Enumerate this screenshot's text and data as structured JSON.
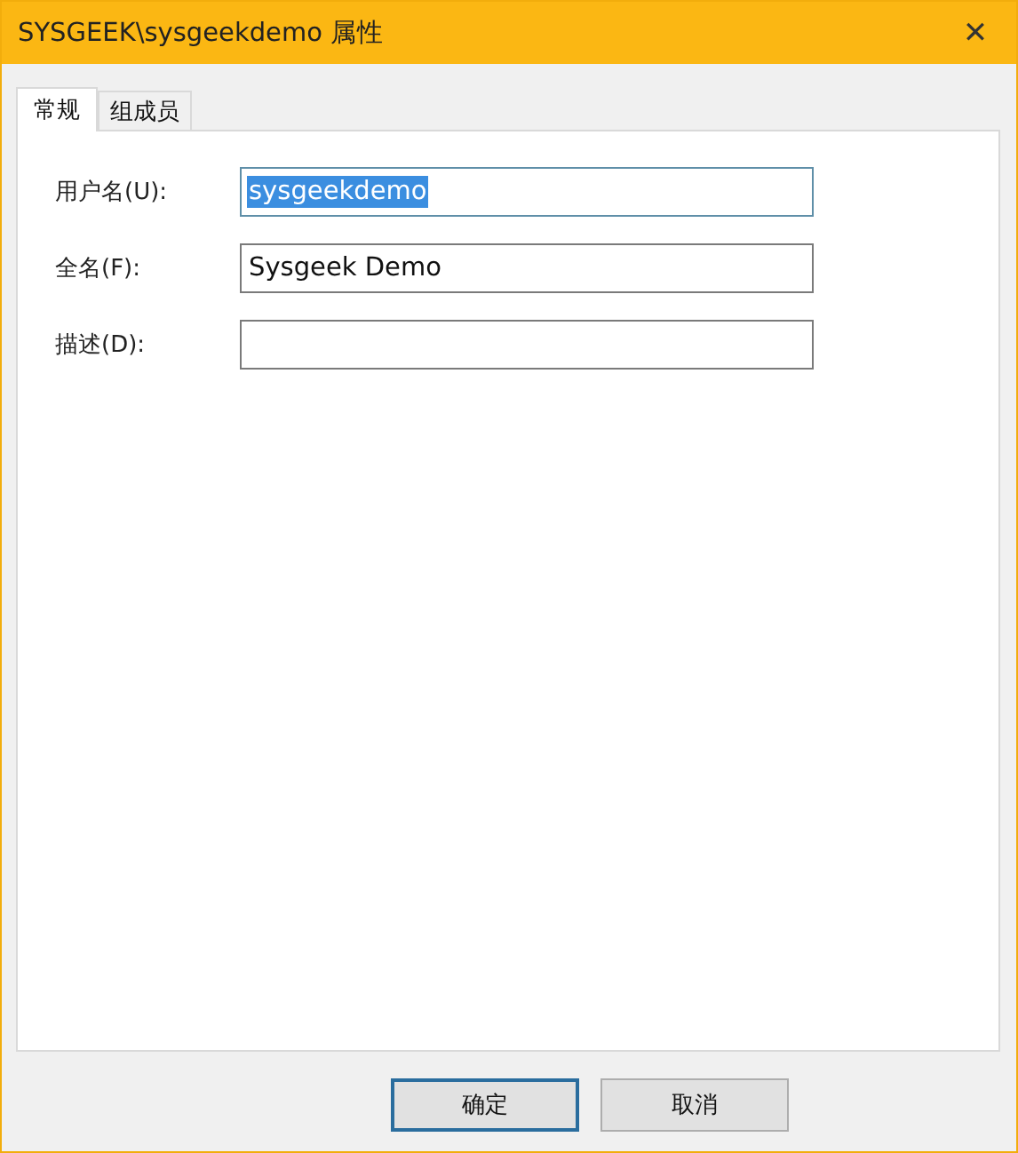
{
  "window": {
    "title": "SYSGEEK\\sysgeekdemo 属性",
    "close": "✕"
  },
  "tabs": [
    {
      "label": "常规",
      "selected": true
    },
    {
      "label": "组成员",
      "selected": false
    }
  ],
  "fields": [
    {
      "label": "用户名(U):",
      "value": "sysgeekdemo",
      "highlighted": true
    },
    {
      "label": "全名(F):",
      "value": "Sysgeek Demo",
      "highlighted": false
    },
    {
      "label": "描述(D):",
      "highlighted": false
    }
  ],
  "buttons": [
    {
      "label": "确定",
      "default": true
    },
    {
      "label": "取消",
      "default": false
    }
  ]
}
